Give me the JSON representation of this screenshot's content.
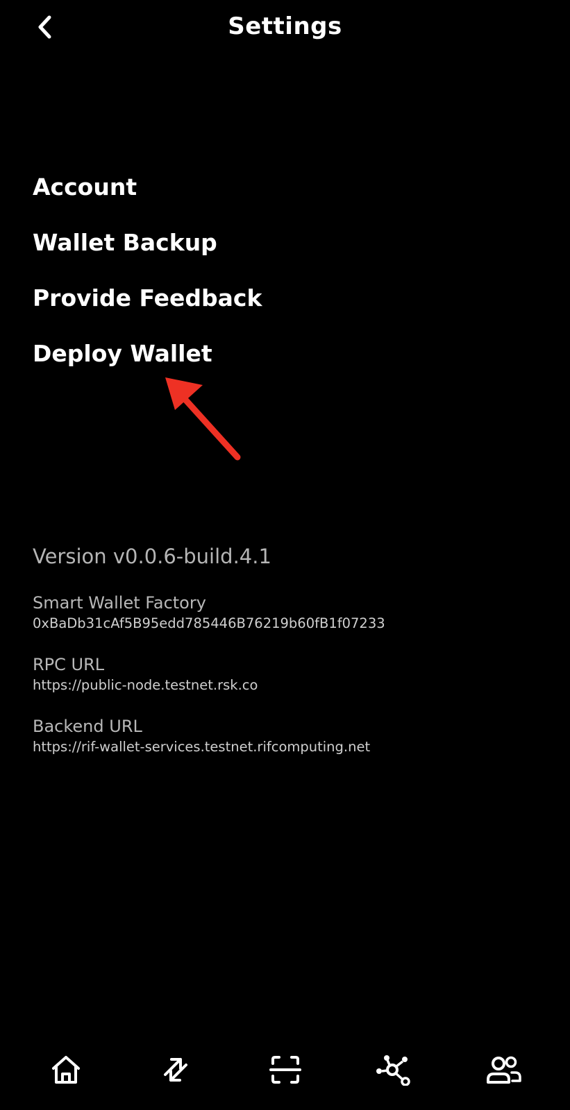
{
  "header": {
    "back_icon": "chevron-left-icon",
    "title": "Settings"
  },
  "menu": {
    "items": [
      {
        "label": "Account"
      },
      {
        "label": "Wallet Backup"
      },
      {
        "label": "Provide Feedback"
      },
      {
        "label": "Deploy Wallet"
      }
    ]
  },
  "annotation": {
    "icon": "red-arrow-annotation",
    "color": "#ee3124"
  },
  "info": {
    "version": "Version v0.0.6-build.4.1",
    "smart_wallet_factory": {
      "label": "Smart Wallet Factory",
      "value": "0xBaDb31cAf5B95edd785446B76219b60fB1f07233"
    },
    "rpc_url": {
      "label": "RPC URL",
      "value": "https://public-node.testnet.rsk.co"
    },
    "backend_url": {
      "label": "Backend URL",
      "value": "https://rif-wallet-services.testnet.rifcomputing.net"
    }
  },
  "tabbar": {
    "tabs": [
      {
        "icon": "home-icon"
      },
      {
        "icon": "transfer-icon"
      },
      {
        "icon": "scan-icon"
      },
      {
        "icon": "dapps-network-icon"
      },
      {
        "icon": "contacts-icon"
      }
    ]
  },
  "colors": {
    "background": "#000000",
    "text_primary": "#ffffff",
    "text_secondary": "#b5b5b5",
    "accent_annotation": "#ee3124"
  }
}
